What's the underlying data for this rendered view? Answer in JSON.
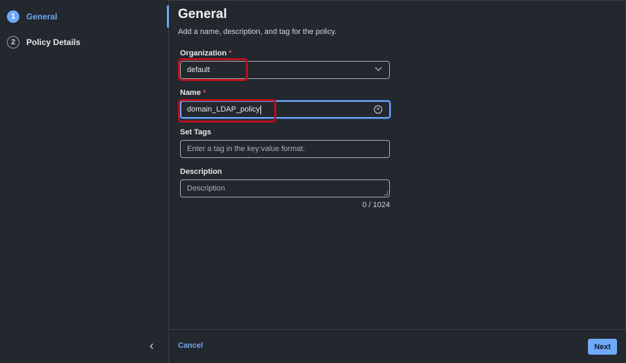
{
  "sidebar": {
    "steps": [
      {
        "number": "1",
        "label": "General"
      },
      {
        "number": "2",
        "label": "Policy Details"
      }
    ],
    "collapse_icon": "chevron-left-icon"
  },
  "main": {
    "title": "General",
    "subtitle": "Add a name, description, and tag for the policy.",
    "organization": {
      "label": "Organization",
      "required_mark": "*",
      "value": "default"
    },
    "name": {
      "label": "Name",
      "required_mark": "*",
      "value": "domain_LDAP_policy"
    },
    "tags": {
      "label": "Set Tags",
      "placeholder": "Enter a tag in the key:value format."
    },
    "description": {
      "label": "Description",
      "placeholder": "Description",
      "counter": "0 / 1024"
    }
  },
  "footer": {
    "cancel_label": "Cancel",
    "next_label": "Next"
  },
  "colors": {
    "accent": "#6fa8f7",
    "background": "#23272e",
    "required": "#e5484d",
    "highlight": "#b8111c"
  }
}
